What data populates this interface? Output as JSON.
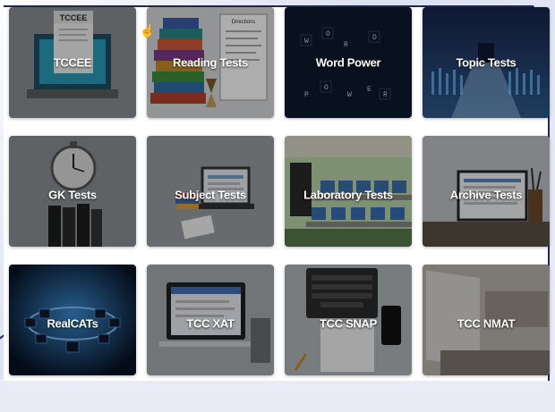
{
  "tiles": [
    {
      "label": "TCCEE"
    },
    {
      "label": "Reading Tests"
    },
    {
      "label": "Word Power"
    },
    {
      "label": "Topic Tests"
    },
    {
      "label": "GK Tests"
    },
    {
      "label": "Subject Tests"
    },
    {
      "label": "Laboratory Tests"
    },
    {
      "label": "Archive Tests"
    },
    {
      "label": "RealCATs"
    },
    {
      "label": "TCC XAT"
    },
    {
      "label": "TCC SNAP"
    },
    {
      "label": "TCC NMAT"
    }
  ],
  "art_text": {
    "tccee_sign": "TCCEE",
    "reading_sheet_title": "Directions",
    "word_power_letters": [
      "W",
      "O",
      "R",
      "D",
      "P",
      "O",
      "W",
      "E",
      "R"
    ]
  },
  "colors": {
    "frame_border": "#1e2560",
    "page_bg": "#e9ecf7",
    "label_text": "#ffffff"
  }
}
